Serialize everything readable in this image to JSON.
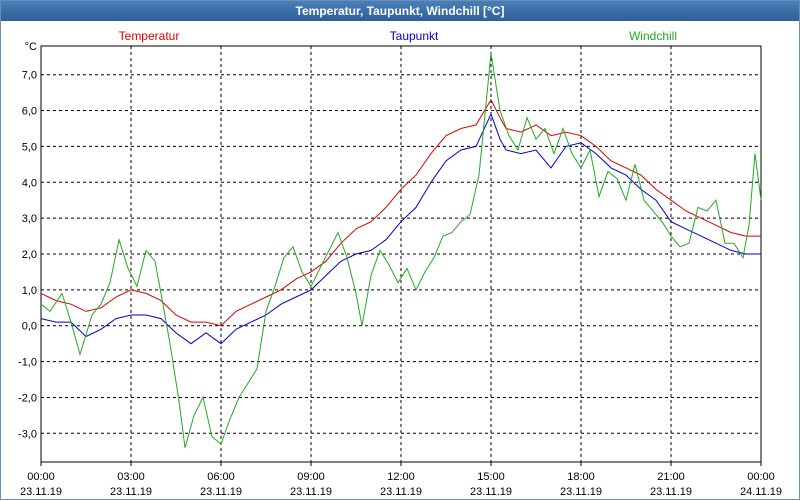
{
  "window": {
    "title": "Temperatur, Taupunkt, Windchill [°C]"
  },
  "chart_data": {
    "type": "line",
    "title": "Temperatur, Taupunkt, Windchill [°C]",
    "ylabel": "°C",
    "ylim": [
      -3.8,
      7.8
    ],
    "yticks": [
      -3.0,
      -2.0,
      -1.0,
      0.0,
      1.0,
      2.0,
      3.0,
      4.0,
      5.0,
      6.0,
      7.0
    ],
    "ytick_labels": [
      "-3,0",
      "-2,0",
      "-1,0",
      "0,0",
      "1,0",
      "2,0",
      "3,0",
      "4,0",
      "5,0",
      "6,0",
      "7,0"
    ],
    "xlim": [
      0,
      24
    ],
    "xticks": [
      0,
      3,
      6,
      9,
      12,
      15,
      18,
      21,
      24
    ],
    "xtick_time": [
      "00:00",
      "03:00",
      "06:00",
      "09:00",
      "12:00",
      "15:00",
      "18:00",
      "21:00",
      "00:00"
    ],
    "xtick_date": [
      "23.11.19",
      "23.11.19",
      "23.11.19",
      "23.11.19",
      "23.11.19",
      "23.11.19",
      "23.11.19",
      "23.11.19",
      "24.11.19"
    ],
    "grid": true,
    "series": [
      {
        "name": "Temperatur",
        "color": "#dd0000",
        "points": [
          [
            0,
            0.9
          ],
          [
            0.5,
            0.7
          ],
          [
            1,
            0.6
          ],
          [
            1.5,
            0.4
          ],
          [
            2,
            0.5
          ],
          [
            2.5,
            0.8
          ],
          [
            3,
            1.0
          ],
          [
            3.5,
            0.9
          ],
          [
            4,
            0.7
          ],
          [
            4.5,
            0.3
          ],
          [
            5,
            0.1
          ],
          [
            5.5,
            0.1
          ],
          [
            6,
            0.0
          ],
          [
            6.5,
            0.4
          ],
          [
            7,
            0.6
          ],
          [
            7.5,
            0.8
          ],
          [
            8,
            1.0
          ],
          [
            8.5,
            1.3
          ],
          [
            9,
            1.5
          ],
          [
            9.5,
            1.8
          ],
          [
            10,
            2.3
          ],
          [
            10.5,
            2.7
          ],
          [
            11,
            2.9
          ],
          [
            11.5,
            3.3
          ],
          [
            12,
            3.8
          ],
          [
            12.5,
            4.2
          ],
          [
            13,
            4.8
          ],
          [
            13.5,
            5.3
          ],
          [
            14,
            5.5
          ],
          [
            14.5,
            5.6
          ],
          [
            15,
            6.3
          ],
          [
            15.3,
            5.8
          ],
          [
            15.5,
            5.5
          ],
          [
            16,
            5.4
          ],
          [
            16.5,
            5.6
          ],
          [
            17,
            5.3
          ],
          [
            17.5,
            5.4
          ],
          [
            18,
            5.3
          ],
          [
            18.5,
            5.0
          ],
          [
            19,
            4.6
          ],
          [
            19.5,
            4.4
          ],
          [
            20,
            4.2
          ],
          [
            20.5,
            3.8
          ],
          [
            21,
            3.5
          ],
          [
            21.5,
            3.2
          ],
          [
            22,
            3.0
          ],
          [
            22.5,
            2.8
          ],
          [
            23,
            2.6
          ],
          [
            23.5,
            2.5
          ],
          [
            24,
            2.5
          ]
        ]
      },
      {
        "name": "Taupunkt",
        "color": "#0000cc",
        "points": [
          [
            0,
            0.2
          ],
          [
            0.5,
            0.1
          ],
          [
            1,
            0.1
          ],
          [
            1.5,
            -0.3
          ],
          [
            2,
            -0.1
          ],
          [
            2.5,
            0.2
          ],
          [
            3,
            0.3
          ],
          [
            3.5,
            0.3
          ],
          [
            4,
            0.2
          ],
          [
            4.5,
            -0.2
          ],
          [
            5,
            -0.5
          ],
          [
            5.5,
            -0.2
          ],
          [
            6,
            -0.5
          ],
          [
            6.5,
            -0.1
          ],
          [
            7,
            0.1
          ],
          [
            7.5,
            0.3
          ],
          [
            8,
            0.6
          ],
          [
            8.5,
            0.8
          ],
          [
            9,
            1.0
          ],
          [
            9.5,
            1.4
          ],
          [
            10,
            1.8
          ],
          [
            10.5,
            2.0
          ],
          [
            11,
            2.1
          ],
          [
            11.5,
            2.4
          ],
          [
            12,
            2.9
          ],
          [
            12.5,
            3.3
          ],
          [
            13,
            4.0
          ],
          [
            13.5,
            4.6
          ],
          [
            14,
            4.9
          ],
          [
            14.5,
            5.0
          ],
          [
            15,
            5.9
          ],
          [
            15.3,
            5.2
          ],
          [
            15.5,
            4.9
          ],
          [
            16,
            4.8
          ],
          [
            16.5,
            4.9
          ],
          [
            17,
            4.4
          ],
          [
            17.5,
            5.0
          ],
          [
            18,
            5.1
          ],
          [
            18.5,
            4.8
          ],
          [
            19,
            4.4
          ],
          [
            19.5,
            4.2
          ],
          [
            20,
            3.8
          ],
          [
            20.5,
            3.5
          ],
          [
            21,
            2.9
          ],
          [
            21.5,
            2.7
          ],
          [
            22,
            2.5
          ],
          [
            22.5,
            2.3
          ],
          [
            23,
            2.1
          ],
          [
            23.5,
            2.0
          ],
          [
            24,
            2.0
          ]
        ]
      },
      {
        "name": "Windchill",
        "color": "#22aa22",
        "points": [
          [
            0,
            0.6
          ],
          [
            0.3,
            0.4
          ],
          [
            0.7,
            0.9
          ],
          [
            1,
            0.1
          ],
          [
            1.3,
            -0.8
          ],
          [
            1.7,
            0.3
          ],
          [
            2,
            0.6
          ],
          [
            2.3,
            1.2
          ],
          [
            2.6,
            2.4
          ],
          [
            2.9,
            1.6
          ],
          [
            3.2,
            1.1
          ],
          [
            3.5,
            2.1
          ],
          [
            3.8,
            1.8
          ],
          [
            4,
            0.9
          ],
          [
            4.3,
            -0.5
          ],
          [
            4.6,
            -2.1
          ],
          [
            4.8,
            -3.4
          ],
          [
            5.1,
            -2.5
          ],
          [
            5.4,
            -2.0
          ],
          [
            5.7,
            -3.1
          ],
          [
            6,
            -3.3
          ],
          [
            6.3,
            -2.6
          ],
          [
            6.6,
            -2.0
          ],
          [
            6.9,
            -1.6
          ],
          [
            7.2,
            -1.2
          ],
          [
            7.5,
            0.4
          ],
          [
            7.8,
            1.1
          ],
          [
            8.1,
            1.9
          ],
          [
            8.4,
            2.2
          ],
          [
            8.7,
            1.5
          ],
          [
            9,
            1.1
          ],
          [
            9.3,
            1.6
          ],
          [
            9.6,
            2.1
          ],
          [
            9.9,
            2.6
          ],
          [
            10.2,
            1.9
          ],
          [
            10.5,
            0.9
          ],
          [
            10.7,
            0.0
          ],
          [
            11,
            1.4
          ],
          [
            11.3,
            2.1
          ],
          [
            11.6,
            1.7
          ],
          [
            11.9,
            1.2
          ],
          [
            12.2,
            1.6
          ],
          [
            12.5,
            1.0
          ],
          [
            12.8,
            1.5
          ],
          [
            13.1,
            1.9
          ],
          [
            13.4,
            2.5
          ],
          [
            13.7,
            2.6
          ],
          [
            14,
            2.9
          ],
          [
            14.3,
            3.1
          ],
          [
            14.6,
            4.2
          ],
          [
            15,
            7.6
          ],
          [
            15.3,
            6.0
          ],
          [
            15.6,
            5.3
          ],
          [
            15.9,
            4.9
          ],
          [
            16.2,
            5.8
          ],
          [
            16.5,
            5.2
          ],
          [
            16.8,
            5.5
          ],
          [
            17.1,
            4.8
          ],
          [
            17.4,
            5.5
          ],
          [
            17.7,
            4.8
          ],
          [
            18,
            4.4
          ],
          [
            18.3,
            4.9
          ],
          [
            18.6,
            3.6
          ],
          [
            18.9,
            4.3
          ],
          [
            19.2,
            4.1
          ],
          [
            19.5,
            3.5
          ],
          [
            19.8,
            4.5
          ],
          [
            20.1,
            3.5
          ],
          [
            20.4,
            3.2
          ],
          [
            20.7,
            2.9
          ],
          [
            21,
            2.5
          ],
          [
            21.3,
            2.2
          ],
          [
            21.6,
            2.3
          ],
          [
            21.9,
            3.3
          ],
          [
            22.2,
            3.2
          ],
          [
            22.5,
            3.5
          ],
          [
            22.8,
            2.3
          ],
          [
            23.1,
            2.3
          ],
          [
            23.4,
            1.9
          ],
          [
            23.6,
            2.8
          ],
          [
            23.8,
            4.8
          ],
          [
            24,
            3.5
          ]
        ]
      }
    ]
  }
}
